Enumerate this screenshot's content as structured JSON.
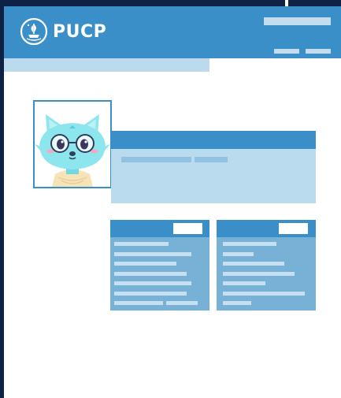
{
  "header": {
    "logo_text": "PUCP",
    "logo_icon": "pucp-seal-icon"
  },
  "avatar": {
    "icon": "cat-with-glasses-avatar"
  },
  "colors": {
    "frame": "#0d2244",
    "brand_blue": "#3a8fc8",
    "light_blue": "#badaee",
    "card_blue": "#78b1d6"
  }
}
